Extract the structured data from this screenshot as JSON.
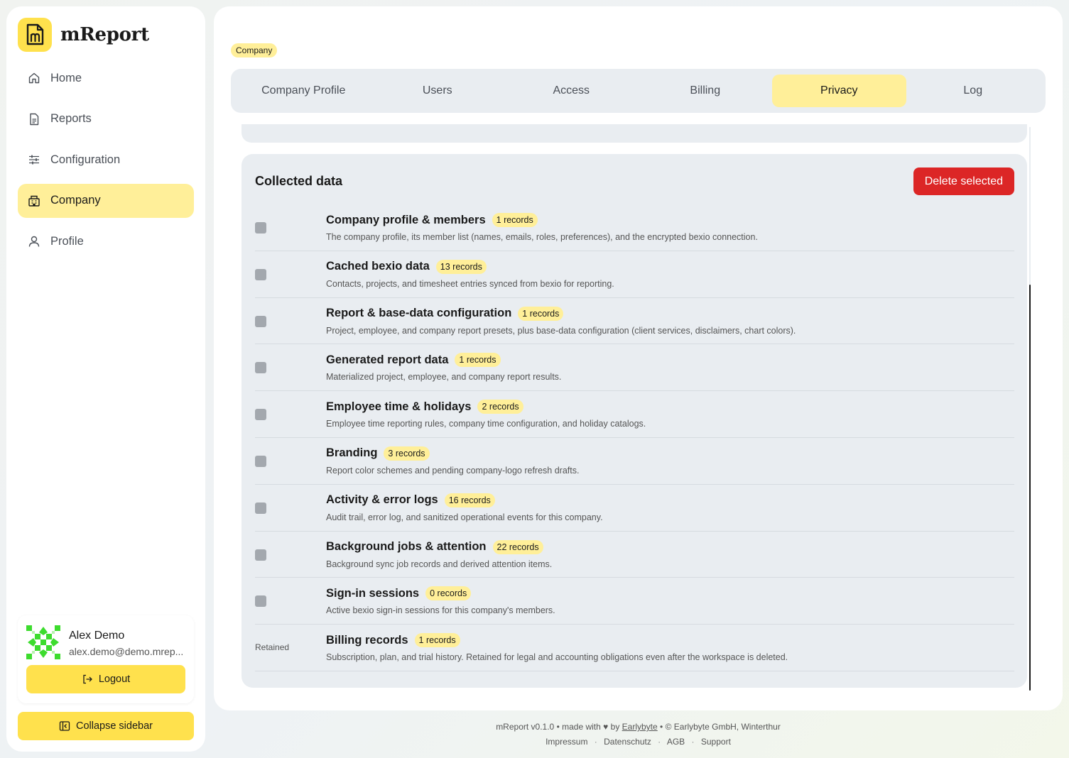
{
  "brand": {
    "name": "mReport",
    "logo_letter": "m"
  },
  "sidebar": {
    "items": [
      {
        "label": "Home",
        "icon": "home-icon",
        "active": false
      },
      {
        "label": "Reports",
        "icon": "report-icon",
        "active": false
      },
      {
        "label": "Configuration",
        "icon": "sliders-icon",
        "active": false
      },
      {
        "label": "Company",
        "icon": "building-icon",
        "active": true
      },
      {
        "label": "Profile",
        "icon": "user-icon",
        "active": false
      }
    ],
    "user": {
      "name": "Alex Demo",
      "email": "alex.demo@demo.mrep..."
    },
    "logout_label": "Logout",
    "collapse_label": "Collapse sidebar"
  },
  "breadcrumb": "Company",
  "tabs": [
    {
      "label": "Company Profile",
      "active": false
    },
    {
      "label": "Users",
      "active": false
    },
    {
      "label": "Access",
      "active": false
    },
    {
      "label": "Billing",
      "active": false
    },
    {
      "label": "Privacy",
      "active": true
    },
    {
      "label": "Log",
      "active": false
    }
  ],
  "collected": {
    "title": "Collected data",
    "delete_label": "Delete selected",
    "rows": [
      {
        "title": "Company profile & members",
        "badge": "1 records",
        "desc": "The company profile, its member list (names, emails, roles, preferences), and the encrypted bexio connection.",
        "retained": false
      },
      {
        "title": "Cached bexio data",
        "badge": "13 records",
        "desc": "Contacts, projects, and timesheet entries synced from bexio for reporting.",
        "retained": false
      },
      {
        "title": "Report & base-data configuration",
        "badge": "1 records",
        "desc": "Project, employee, and company report presets, plus base-data configuration (client services, disclaimers, chart colors).",
        "retained": false
      },
      {
        "title": "Generated report data",
        "badge": "1 records",
        "desc": "Materialized project, employee, and company report results.",
        "retained": false
      },
      {
        "title": "Employee time & holidays",
        "badge": "2 records",
        "desc": "Employee time reporting rules, company time configuration, and holiday catalogs.",
        "retained": false
      },
      {
        "title": "Branding",
        "badge": "3 records",
        "desc": "Report color schemes and pending company-logo refresh drafts.",
        "retained": false
      },
      {
        "title": "Activity & error logs",
        "badge": "16 records",
        "desc": "Audit trail, error log, and sanitized operational events for this company.",
        "retained": false
      },
      {
        "title": "Background jobs & attention",
        "badge": "22 records",
        "desc": "Background sync job records and derived attention items.",
        "retained": false
      },
      {
        "title": "Sign-in sessions",
        "badge": "0 records",
        "desc": "Active bexio sign-in sessions for this company's members.",
        "retained": false
      },
      {
        "title": "Billing records",
        "badge": "1 records",
        "desc": "Subscription, plan, and trial history. Retained for legal and accounting obligations even after the workspace is deleted.",
        "retained": true,
        "retained_label": "Retained"
      }
    ]
  },
  "footer": {
    "version": "mReport v0.1.0",
    "made_with": "made with",
    "heart": "♥",
    "by": "by",
    "maker": "Earlybyte",
    "copyright": "© Earlybyte GmbH, Winterthur",
    "links": [
      "Impressum",
      "Datenschutz",
      "AGB",
      "Support"
    ]
  },
  "colors": {
    "accent": "#ffe14d",
    "accent_soft": "#ffef99",
    "danger": "#dc2626",
    "panel": "#e9edf1"
  }
}
